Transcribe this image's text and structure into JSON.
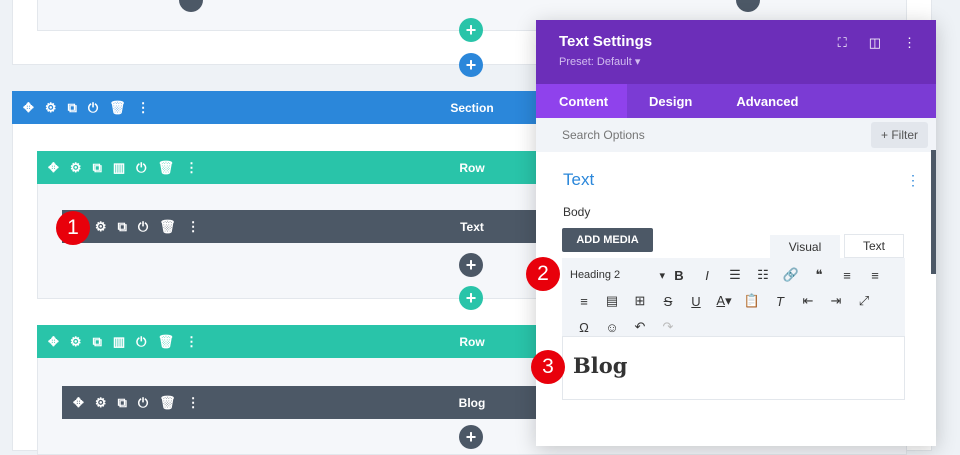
{
  "builder": {
    "section_label": "Section",
    "rows": [
      {
        "label": "Row",
        "module": "Text"
      },
      {
        "label": "Row",
        "module": "Blog"
      }
    ],
    "add_icon": "+"
  },
  "badges": [
    "1",
    "2",
    "3"
  ],
  "panel": {
    "title": "Text Settings",
    "preset": "Preset: Default ▾",
    "tabs": [
      "Content",
      "Design",
      "Advanced"
    ],
    "search_placeholder": "Search Options",
    "filter_label": "+ Filter",
    "group_title": "Text",
    "body_label": "Body",
    "add_media": "ADD MEDIA",
    "editor_tabs": [
      "Visual",
      "Text"
    ],
    "format_select": "Heading 2",
    "content": "Blog"
  },
  "colors": {
    "section": "#2b87da",
    "row": "#29c4a9",
    "module": "#4c5866",
    "panel_header": "#6c2eb9",
    "panel_tabs": "#7b3bd4",
    "badge": "#e8000b"
  }
}
